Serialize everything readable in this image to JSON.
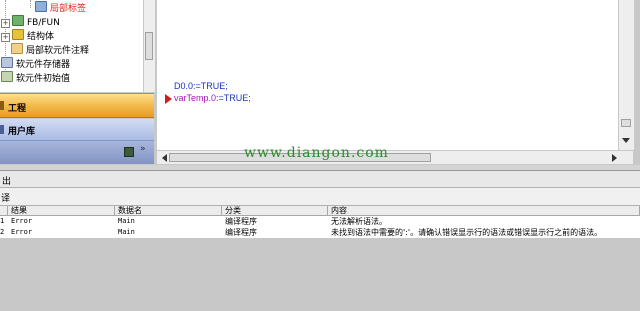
{
  "tree": {
    "items": [
      {
        "label": "局部标签",
        "color": "#e0281c"
      },
      {
        "label": "FB/FUN"
      },
      {
        "label": "结构体"
      },
      {
        "label": "局部软元件注释"
      },
      {
        "label": "软元件存储器"
      },
      {
        "label": "软元件初始值"
      }
    ]
  },
  "nav": {
    "project_label": "工程",
    "library_label": "用户库"
  },
  "editor": {
    "lines": [
      {
        "var": "D0.0",
        "op": ":=",
        "val": "TRUE;"
      },
      {
        "var": "varTemp.0",
        "op": ":=",
        "val": "TRUE;"
      }
    ]
  },
  "watermark": "www.diangon.com",
  "output": {
    "title": "出",
    "subtitle": "译",
    "columns": [
      "结果",
      "数据名",
      "分类",
      "内容"
    ],
    "rows": [
      {
        "no": "1",
        "result": "Error",
        "name": "Main",
        "category": "编译程序",
        "content": "无法解析语法。"
      },
      {
        "no": "2",
        "result": "Error",
        "name": "Main",
        "category": "编译程序",
        "content": "未找到语法中需要的':'。请确认错误显示行的语法或错误显示行之前的语法。"
      }
    ]
  },
  "colors": {
    "keyword_blue": "#1a33cc",
    "var_purple": "#a21bb4",
    "watermark_green": "#2d8a2d"
  }
}
